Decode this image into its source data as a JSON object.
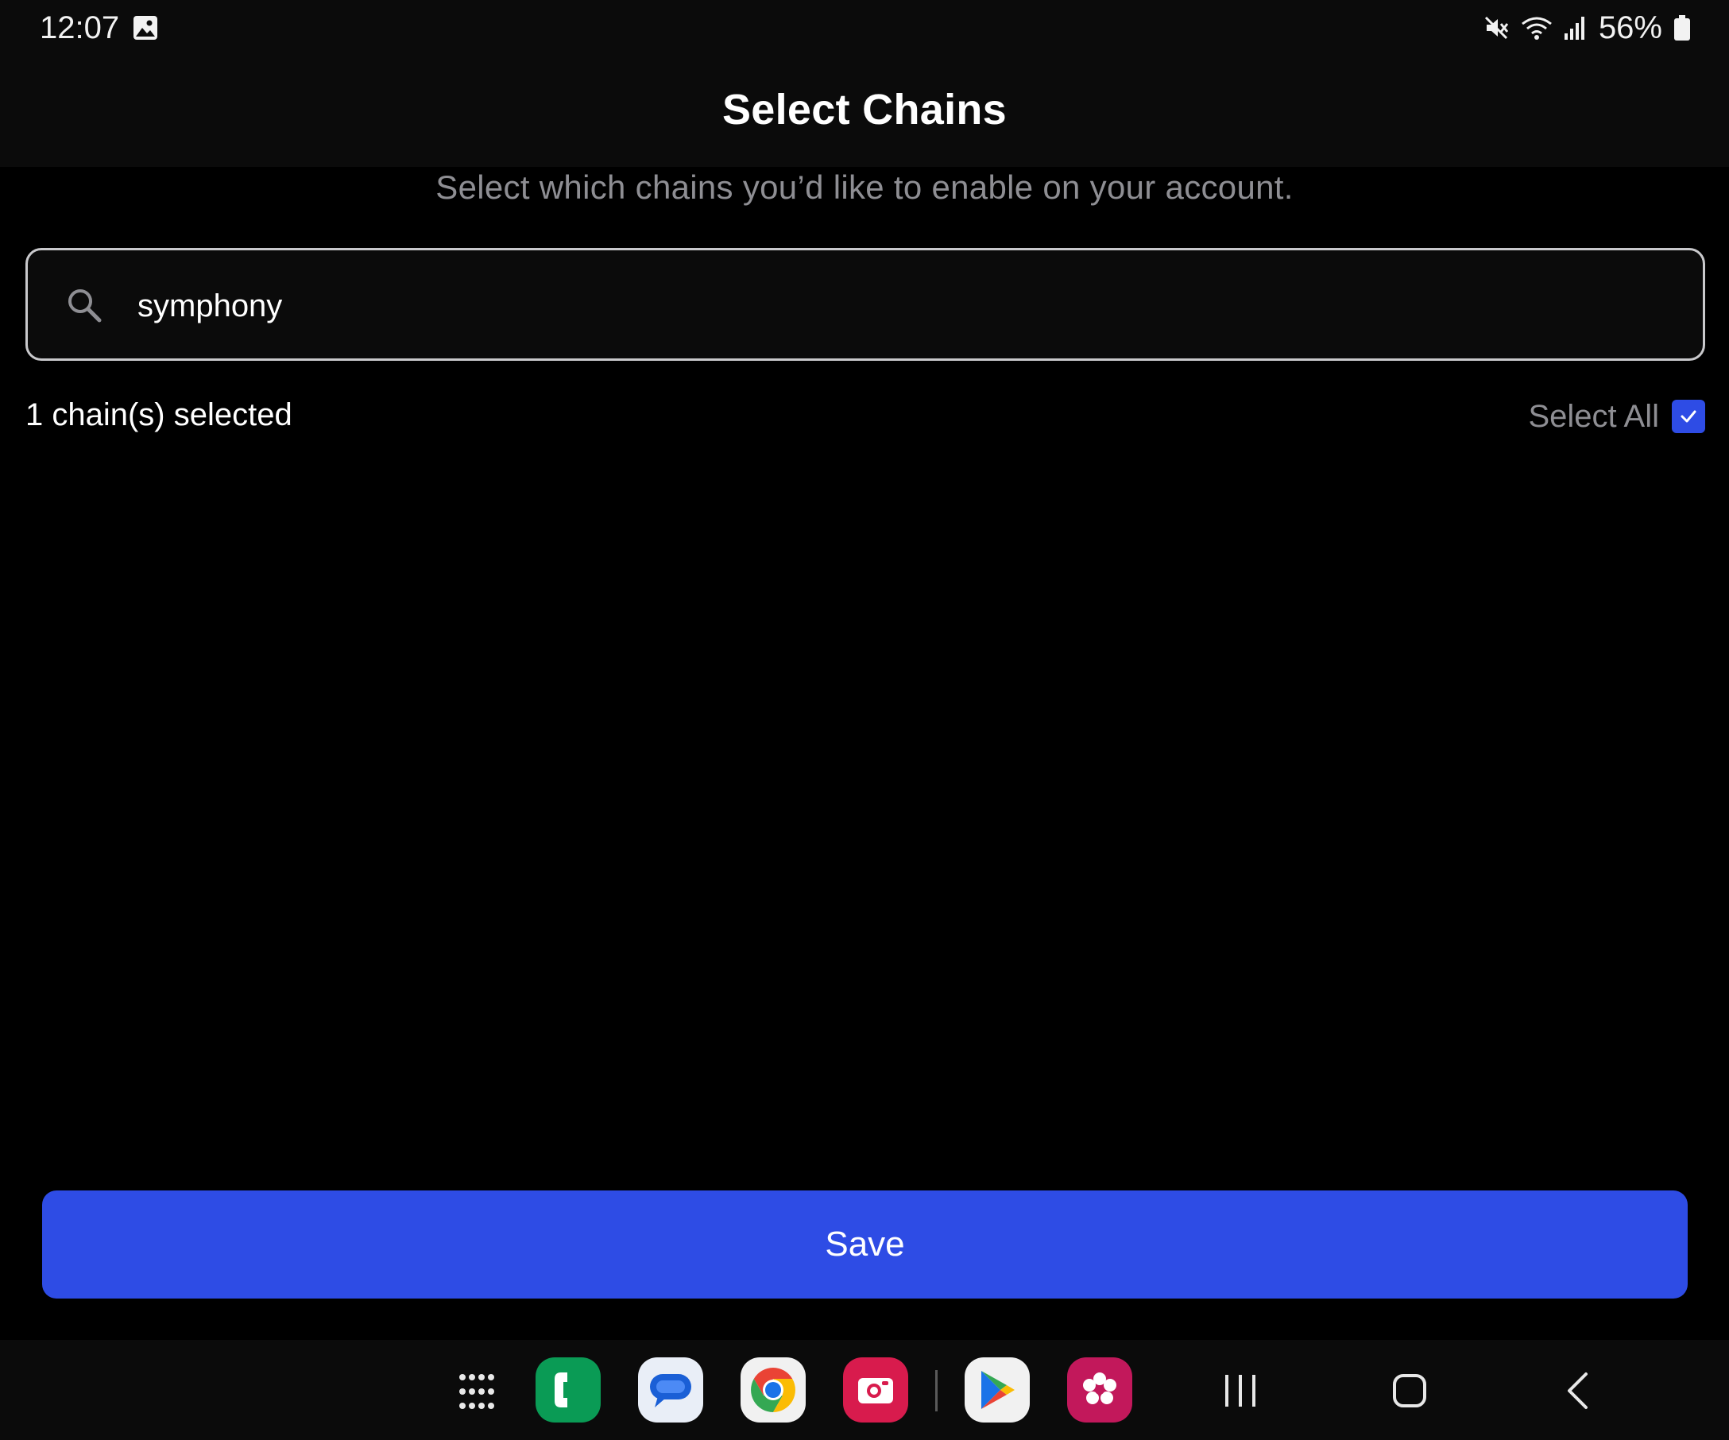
{
  "status_bar": {
    "time": "12:07",
    "battery": "56%",
    "icons": [
      "gallery-notification-icon",
      "mute-icon",
      "wifi-icon",
      "signal-icon",
      "battery-icon"
    ]
  },
  "header": {
    "title": "Select Chains"
  },
  "main": {
    "subtitle": "Select which chains you’d like to enable on your account.",
    "search": {
      "value": "symphony",
      "placeholder": ""
    },
    "selected_count": "1 chain(s) selected",
    "select_all_label": "Select All",
    "select_all_checked": true,
    "save_label": "Save"
  },
  "taskbar": {
    "apps": [
      "app-drawer-icon",
      "phone-icon",
      "messages-icon",
      "chrome-icon",
      "camera-icon",
      "play-store-icon",
      "blossom-icon"
    ],
    "nav": [
      "recent-apps-icon",
      "home-icon",
      "back-icon"
    ]
  },
  "colors": {
    "accent": "#2e4ce5",
    "background": "#000000",
    "header_bg": "#0b0b0b",
    "muted_text": "#8e8e93"
  }
}
